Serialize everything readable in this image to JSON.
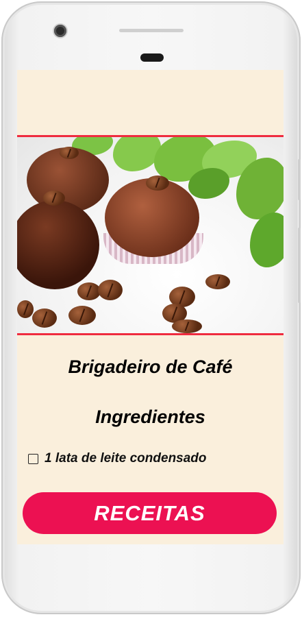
{
  "recipe": {
    "title": "Brigadeiro de Café",
    "section_heading": "Ingredientes",
    "ingredients": [
      {
        "label": "1 lata de leite condensado",
        "checked": false
      }
    ]
  },
  "actions": {
    "primary_label": "RECEITAS"
  },
  "hero_image": {
    "icon": "brigadeiro-photo"
  },
  "colors": {
    "screen_background": "#faefdc",
    "divider": "#ef2b3f",
    "button": "#ec1152",
    "button_text": "#ffffff"
  }
}
